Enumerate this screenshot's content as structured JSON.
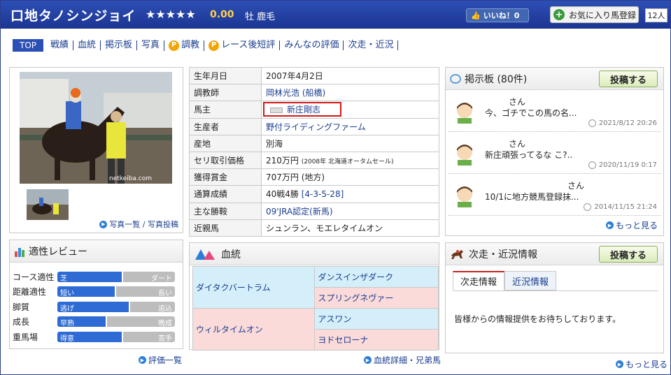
{
  "header": {
    "horse_name": "口地タノシンジョイ",
    "stars": "★★★★★",
    "rating": "0.00",
    "sex_coat": "牡  鹿毛",
    "like_label": "いいね！0",
    "fav_label": "お気に入り馬登録",
    "fav_count": "12人"
  },
  "nav": {
    "items": [
      "TOP",
      "戦績",
      "血統",
      "掲示板",
      "写真",
      "調教",
      "レース後短評",
      "みんなの評価",
      "次走・近況"
    ]
  },
  "photo": {
    "watermark": "netkeiba.com",
    "links": "写真一覧 / 写真投稿"
  },
  "profile": {
    "rows": [
      {
        "key": "生年月日",
        "value": "2007年4月2日"
      },
      {
        "key": "調教師",
        "value": "岡林光浩 (船橋)"
      },
      {
        "key": "馬主",
        "value": "新庄剛志"
      },
      {
        "key": "生産者",
        "value": "野付ライディングファーム"
      },
      {
        "key": "産地",
        "value": "別海"
      },
      {
        "key": "セリ取引価格",
        "value": "210万円",
        "note": "(2008年 北海道オータムセール)"
      },
      {
        "key": "獲得賞金",
        "value": "707万円 (地方)"
      },
      {
        "key": "通算成績",
        "value": "40戦4勝",
        "link": "[4-3-5-28]"
      },
      {
        "key": "主な勝鞍",
        "value": "09'JRA認定(新馬)"
      },
      {
        "key": "近親馬",
        "value": "シュンラン、モエレタイムオン"
      }
    ]
  },
  "board": {
    "title": "掲示板 (80件)",
    "post_button": "投稿する",
    "posts": [
      {
        "author": "さん",
        "text": "今、ゴチでこの馬の名...",
        "date": "2021/8/12 20:26"
      },
      {
        "author": "さん",
        "text": "新庄頑張ってるな こ?..",
        "date": "2020/11/19 0:17"
      },
      {
        "author": "さん",
        "text": "10/1に地方競馬登録抹...",
        "date": "2014/11/15 21:24"
      }
    ],
    "more": "もっと見る"
  },
  "aptitude": {
    "title": "適性レビュー",
    "rows": [
      {
        "label": "コース適性",
        "left": "芝",
        "right": "ダート",
        "value": 0.56
      },
      {
        "label": "距離適性",
        "left": "短い",
        "right": "長い",
        "value": 0.5
      },
      {
        "label": "脚質",
        "left": "逃げ",
        "right": "追込",
        "value": 0.62
      },
      {
        "label": "成長",
        "left": "早熟",
        "right": "晩成",
        "value": 0.42
      },
      {
        "label": "重馬場",
        "left": "得意",
        "right": "苦手",
        "value": 0.56
      }
    ],
    "more": "評価一覧"
  },
  "pedigree": {
    "title": "血統",
    "sire": "ダイタクバートラム",
    "sire_sire": "ダンスインザダーク",
    "sire_dam": "スプリングネヴァー",
    "dam": "ウィルタイムオン",
    "dam_sire": "アスワン",
    "dam_dam": "ヨドセローナ",
    "more": "血統詳細・兄弟馬"
  },
  "next_race": {
    "title": "次走・近況情報",
    "post_button": "投稿する",
    "tabs": [
      "次走情報",
      "近況情報"
    ],
    "message": "皆様からの情報提供をお待ちしております。",
    "more": "もっと見る"
  },
  "colors": {
    "header_blue": "#1c3592",
    "link_blue": "#1a3d8f",
    "sire_bg": "#d4effa",
    "dam_bg": "#fbdada",
    "accent_red": "#d01818"
  }
}
